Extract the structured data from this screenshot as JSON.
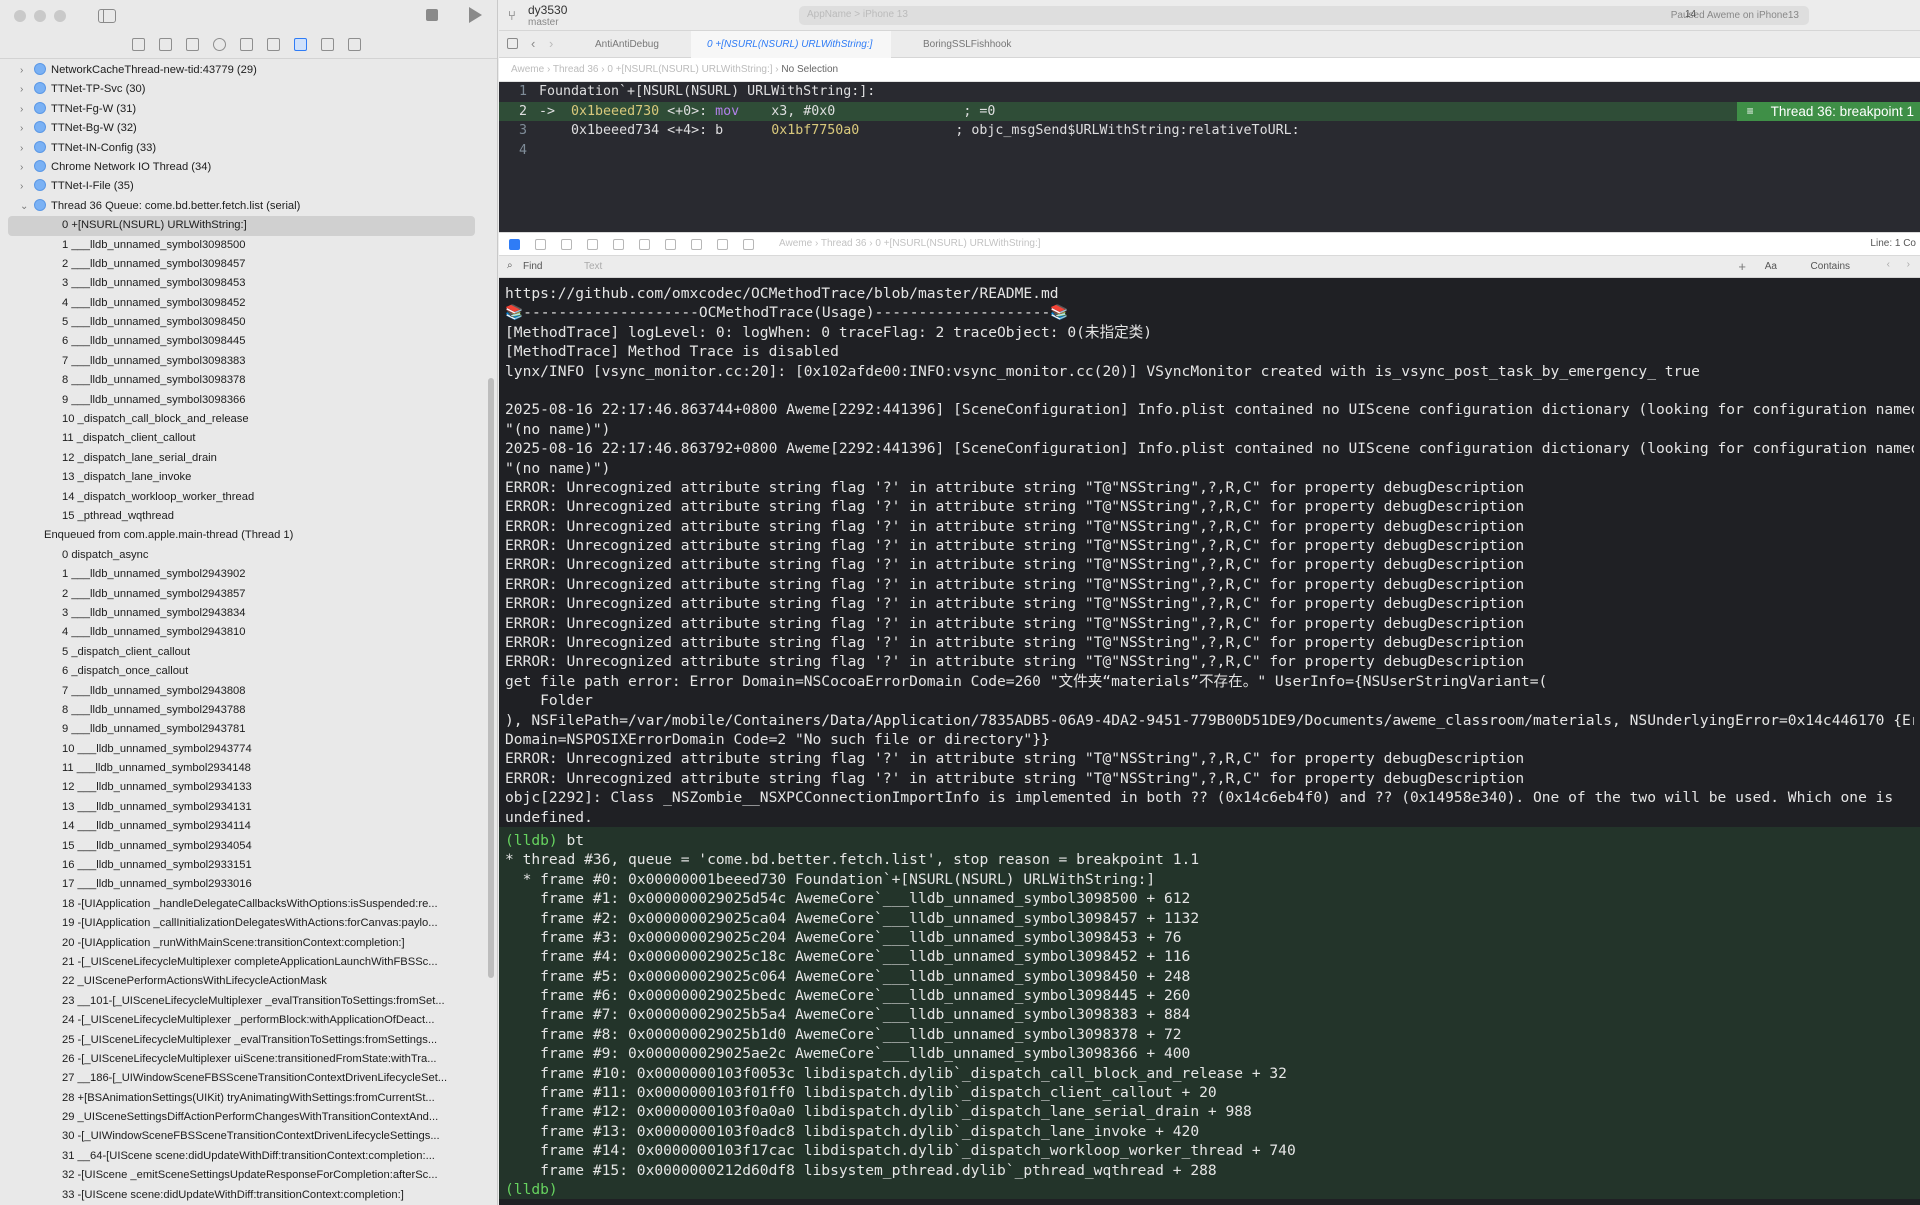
{
  "window": {
    "scheme": "dy3530",
    "branch": "master",
    "status_destination": "AppName  >  iPhone 13",
    "status_text": "Paused Aweme on iPhone13",
    "warnings_count": "14"
  },
  "tabs": [
    {
      "label": "AntiAntiDebug"
    },
    {
      "label": "0 +[NSURL(NSURL) URLWithString:]"
    },
    {
      "label": "BoringSSLFishhook"
    }
  ],
  "jumpbar": {
    "app": "Aweme",
    "thread": "Thread 36",
    "frame": "0 +[NSURL(NSURL) URLWithString:]",
    "selection": "No Selection"
  },
  "threads_before": [
    {
      "label": "NetworkCacheThread-new-tid:43779 (29)"
    },
    {
      "label": "TTNet-TP-Svc (30)"
    },
    {
      "label": "TTNet-Fg-W (31)"
    },
    {
      "label": "TTNet-Bg-W (32)"
    },
    {
      "label": "TTNet-IN-Config (33)"
    },
    {
      "label": "Chrome Network IO Thread (34)"
    },
    {
      "label": "TTNet-I-File (35)"
    }
  ],
  "current_thread": {
    "label": "Thread 36 Queue: come.bd.better.fetch.list (serial)"
  },
  "frames": [
    "0 +[NSURL(NSURL) URLWithString:]",
    "1 ___lldb_unnamed_symbol3098500",
    "2 ___lldb_unnamed_symbol3098457",
    "3 ___lldb_unnamed_symbol3098453",
    "4 ___lldb_unnamed_symbol3098452",
    "5 ___lldb_unnamed_symbol3098450",
    "6 ___lldb_unnamed_symbol3098445",
    "7 ___lldb_unnamed_symbol3098383",
    "8 ___lldb_unnamed_symbol3098378",
    "9 ___lldb_unnamed_symbol3098366",
    "10 _dispatch_call_block_and_release",
    "11 _dispatch_client_callout",
    "12 _dispatch_lane_serial_drain",
    "13 _dispatch_lane_invoke",
    "14 _dispatch_workloop_worker_thread",
    "15 _pthread_wqthread"
  ],
  "enqueued_header": "Enqueued from com.apple.main-thread (Thread 1)",
  "enqueued_frames": [
    "0 dispatch_async",
    "1 ___lldb_unnamed_symbol2943902",
    "2 ___lldb_unnamed_symbol2943857",
    "3 ___lldb_unnamed_symbol2943834",
    "4 ___lldb_unnamed_symbol2943810",
    "5 _dispatch_client_callout",
    "6 _dispatch_once_callout",
    "7 ___lldb_unnamed_symbol2943808",
    "8 ___lldb_unnamed_symbol2943788",
    "9 ___lldb_unnamed_symbol2943781",
    "10 ___lldb_unnamed_symbol2943774",
    "11 ___lldb_unnamed_symbol2934148",
    "12 ___lldb_unnamed_symbol2934133",
    "13 ___lldb_unnamed_symbol2934131",
    "14 ___lldb_unnamed_symbol2934114",
    "15 ___lldb_unnamed_symbol2934054",
    "16 ___lldb_unnamed_symbol2933151",
    "17 ___lldb_unnamed_symbol2933016",
    "18 -[UIApplication _handleDelegateCallbacksWithOptions:isSuspended:re...",
    "19 -[UIApplication _callInitializationDelegatesWithActions:forCanvas:paylo...",
    "20 -[UIApplication _runWithMainScene:transitionContext:completion:]",
    "21 -[_UISceneLifecycleMultiplexer completeApplicationLaunchWithFBSSc...",
    "22 _UIScenePerformActionsWithLifecycleActionMask",
    "23 __101-[_UISceneLifecycleMultiplexer _evalTransitionToSettings:fromSet...",
    "24 -[_UISceneLifecycleMultiplexer _performBlock:withApplicationOfDeact...",
    "25 -[_UISceneLifecycleMultiplexer _evalTransitionToSettings:fromSettings...",
    "26 -[_UISceneLifecycleMultiplexer uiScene:transitionedFromState:withTra...",
    "27 __186-[_UIWindowSceneFBSSceneTransitionContextDrivenLifecycleSet...",
    "28 +[BSAnimationSettings(UIKit) tryAnimatingWithSettings:fromCurrentSt...",
    "29 _UISceneSettingsDiffActionPerformChangesWithTransitionContextAnd...",
    "30 -[_UIWindowSceneFBSSceneTransitionContextDrivenLifecycleSettings...",
    "31 __64-[UIScene scene:didUpdateWithDiff:transitionContext:completion:...",
    "32 -[UIScene _emitSceneSettingsUpdateResponseForCompletion:afterSc...",
    "33 -[UIScene scene:didUpdateWithDiff:transitionContext:completion:]"
  ],
  "editor": {
    "line1": "Foundation`+[NSURL(NSURL) URLWithString:]:",
    "line2": {
      "arrow": "->",
      "addr": "0x1beeed730",
      "off": "<+0>:",
      "mnem": "mov",
      "ops": "x3, #0x0",
      "comment": "; =0"
    },
    "line3": {
      "addr": "0x1beeed734",
      "off": "<+4>:",
      "mnem": "b",
      "target": "0x1bf7750a0",
      "comment": "; objc_msgSend$URLWithString:relativeToURL:"
    },
    "breakpoint_badge": "Thread 36: breakpoint 1"
  },
  "debugbar": {
    "line_col": "Line: 1  Co"
  },
  "find": {
    "label": "Find",
    "placeholder": "Text",
    "aa": "Aa",
    "mode": "Contains"
  },
  "console_lines": [
    "https://github.com/omxcodec/OCMethodTrace/blob/master/README.md",
    "📚--------------------OCMethodTrace(Usage)--------------------📚",
    "[MethodTrace] logLevel: 0: logWhen: 0 traceFlag: 2 traceObject: 0(未指定类)",
    "[MethodTrace] Method Trace is disabled",
    "lynx/INFO [vsync_monitor.cc:20]: [0x102afde00:INFO:vsync_monitor.cc(20)] VSyncMonitor created with is_vsync_post_task_by_emergency_ true",
    "",
    "2025-08-16 22:17:46.863744+0800 Aweme[2292:441396] [SceneConfiguration] Info.plist contained no UIScene configuration dictionary (looking for configuration named",
    "\"(no name)\")",
    "2025-08-16 22:17:46.863792+0800 Aweme[2292:441396] [SceneConfiguration] Info.plist contained no UIScene configuration dictionary (looking for configuration named",
    "\"(no name)\")",
    "ERROR: Unrecognized attribute string flag '?' in attribute string \"T@\"NSString\",?,R,C\" for property debugDescription",
    "ERROR: Unrecognized attribute string flag '?' in attribute string \"T@\"NSString\",?,R,C\" for property debugDescription",
    "ERROR: Unrecognized attribute string flag '?' in attribute string \"T@\"NSString\",?,R,C\" for property debugDescription",
    "ERROR: Unrecognized attribute string flag '?' in attribute string \"T@\"NSString\",?,R,C\" for property debugDescription",
    "ERROR: Unrecognized attribute string flag '?' in attribute string \"T@\"NSString\",?,R,C\" for property debugDescription",
    "ERROR: Unrecognized attribute string flag '?' in attribute string \"T@\"NSString\",?,R,C\" for property debugDescription",
    "ERROR: Unrecognized attribute string flag '?' in attribute string \"T@\"NSString\",?,R,C\" for property debugDescription",
    "ERROR: Unrecognized attribute string flag '?' in attribute string \"T@\"NSString\",?,R,C\" for property debugDescription",
    "ERROR: Unrecognized attribute string flag '?' in attribute string \"T@\"NSString\",?,R,C\" for property debugDescription",
    "ERROR: Unrecognized attribute string flag '?' in attribute string \"T@\"NSString\",?,R,C\" for property debugDescription",
    "get file path error: Error Domain=NSCocoaErrorDomain Code=260 \"文件夹“materials”不存在。\" UserInfo={NSUserStringVariant=(",
    "    Folder",
    "), NSFilePath=/var/mobile/Containers/Data/Application/7835ADB5-06A9-4DA2-9451-779B00D51DE9/Documents/aweme_classroom/materials, NSUnderlyingError=0x14c446170 {Error",
    "Domain=NSPOSIXErrorDomain Code=2 \"No such file or directory\"}}",
    "ERROR: Unrecognized attribute string flag '?' in attribute string \"T@\"NSString\",?,R,C\" for property debugDescription",
    "ERROR: Unrecognized attribute string flag '?' in attribute string \"T@\"NSString\",?,R,C\" for property debugDescription",
    "objc[2292]: Class _NSZombie__NSXPCConnectionImportInfo is implemented in both ?? (0x14c6eb4f0) and ?? (0x14958e340). One of the two will be used. Which one is",
    "undefined."
  ],
  "bt_prompt": "(lldb)",
  "bt_command": "bt",
  "bt_lines": [
    "* thread #36, queue = 'come.bd.better.fetch.list', stop reason = breakpoint 1.1",
    "  * frame #0: 0x00000001beeed730 Foundation`+[NSURL(NSURL) URLWithString:]",
    "    frame #1: 0x000000029025d54c AwemeCore`___lldb_unnamed_symbol3098500 + 612",
    "    frame #2: 0x000000029025ca04 AwemeCore`___lldb_unnamed_symbol3098457 + 1132",
    "    frame #3: 0x000000029025c204 AwemeCore`___lldb_unnamed_symbol3098453 + 76",
    "    frame #4: 0x000000029025c18c AwemeCore`___lldb_unnamed_symbol3098452 + 116",
    "    frame #5: 0x000000029025c064 AwemeCore`___lldb_unnamed_symbol3098450 + 248",
    "    frame #6: 0x000000029025bedc AwemeCore`___lldb_unnamed_symbol3098445 + 260",
    "    frame #7: 0x000000029025b5a4 AwemeCore`___lldb_unnamed_symbol3098383 + 884",
    "    frame #8: 0x000000029025b1d0 AwemeCore`___lldb_unnamed_symbol3098378 + 72",
    "    frame #9: 0x000000029025ae2c AwemeCore`___lldb_unnamed_symbol3098366 + 400",
    "    frame #10: 0x0000000103f0053c libdispatch.dylib`_dispatch_call_block_and_release + 32",
    "    frame #11: 0x0000000103f01ff0 libdispatch.dylib`_dispatch_client_callout + 20",
    "    frame #12: 0x0000000103f0a0a0 libdispatch.dylib`_dispatch_lane_serial_drain + 988",
    "    frame #13: 0x0000000103f0adc8 libdispatch.dylib`_dispatch_lane_invoke + 420",
    "    frame #14: 0x0000000103f17cac libdispatch.dylib`_dispatch_workloop_worker_thread + 740",
    "    frame #15: 0x0000000212d60df8 libsystem_pthread.dylib`_pthread_wqthread + 288",
    "(lldb)"
  ],
  "colors": {
    "accent": "#2f7cf6",
    "breakpoint_green": "#3f8f47",
    "editor_bg": "#292a30",
    "console_bg": "#1f2024",
    "bt_bg": "#23342a",
    "prompt": "#66d35f"
  }
}
